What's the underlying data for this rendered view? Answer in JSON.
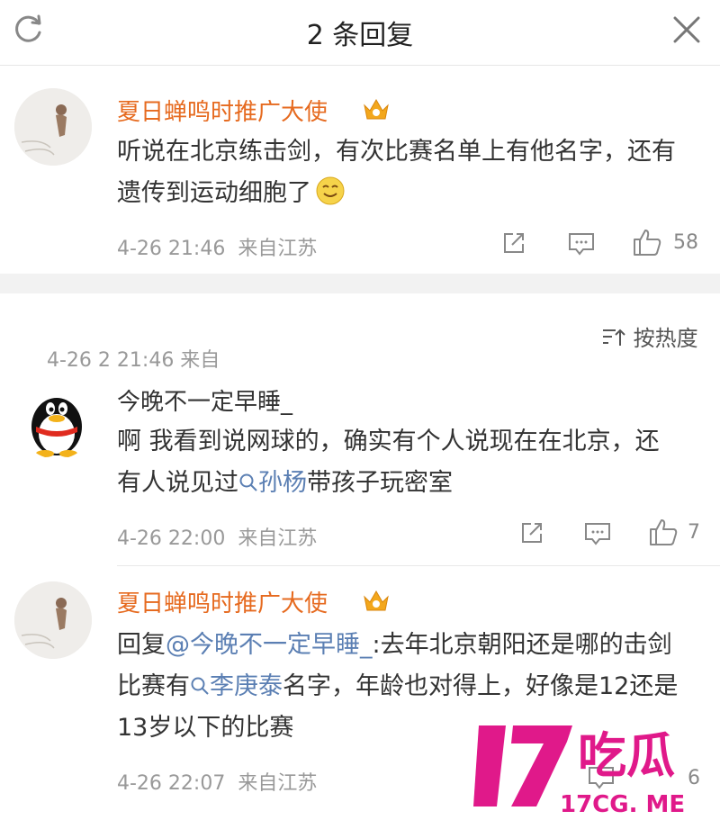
{
  "header": {
    "title": "2 条回复"
  },
  "main_comment": {
    "user": "夏日蝉鸣时推广大使",
    "text": "听说在北京练击剑，有次比赛名单上有他名字，还有遗传到运动细胞了",
    "time": "4-26 21:46",
    "source": "来自江苏",
    "likes": "58"
  },
  "sort": {
    "label": "按热度"
  },
  "partial_meta": "4-26 2 21:46 来自",
  "replies": [
    {
      "user": "今晚不一定早睡_",
      "text_before": "啊 我看到说网球的，确实有个人说现在在北京，还有人说见过",
      "link": "孙杨",
      "text_after": "带孩子玩密室",
      "time": "4-26 22:00",
      "source": "来自江苏",
      "likes": "7"
    },
    {
      "user": "夏日蝉鸣时推广大使",
      "reply_prefix": "回复",
      "mention": "@今晚不一定早睡_",
      "text_1": ":去年北京朝阳还是哪的击剑比赛有",
      "link": "李庚泰",
      "text_2": "名字，年龄也对得上，好像是12还是13岁以下的比赛",
      "time": "4-26 22:07",
      "source": "来自江苏",
      "likes": "6"
    }
  ],
  "watermark": {
    "logo": "17吃瓜",
    "url": "17CG. ME"
  },
  "colors": {
    "accent": "#e66a1f",
    "link": "#5b7fb3",
    "watermark": "#e0198a"
  }
}
